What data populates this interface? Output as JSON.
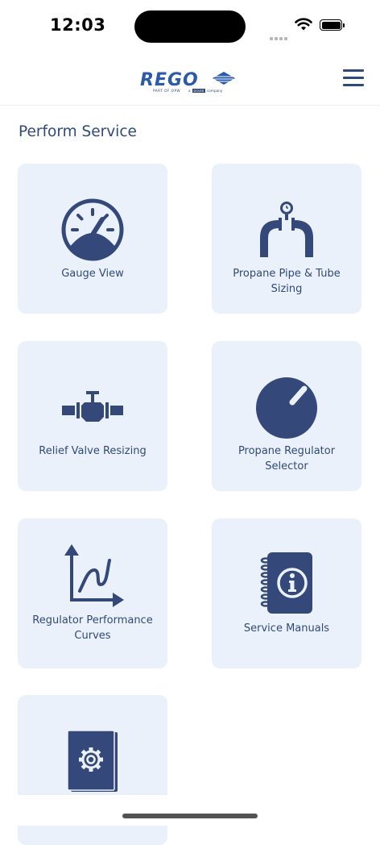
{
  "status": {
    "time": "12:03"
  },
  "header": {
    "logo_text": "REGO",
    "logo_sub_left": "PART OF OPW",
    "logo_sub_mid": "a",
    "logo_sub_brand": "DOVER",
    "logo_sub_right": "company"
  },
  "page": {
    "title": "Perform Service"
  },
  "tiles": [
    {
      "label": "Gauge View"
    },
    {
      "label": "Propane Pipe & Tube Sizing"
    },
    {
      "label": "Relief Valve Resizing"
    },
    {
      "label": "Propane Regulator Selector"
    },
    {
      "label": "Regulator Performance Curves"
    },
    {
      "label": "Service Manuals"
    },
    {
      "label": ""
    }
  ],
  "colors": {
    "accent": "#2f4a7a",
    "tile_bg": "#ebf1fa",
    "icon": "#34487a"
  },
  "icons": [
    "gauge-icon",
    "pipe-icon",
    "valve-icon",
    "regulator-knob-icon",
    "performance-curve-icon",
    "info-manual-icon",
    "settings-manual-icon",
    "menu-icon"
  ]
}
